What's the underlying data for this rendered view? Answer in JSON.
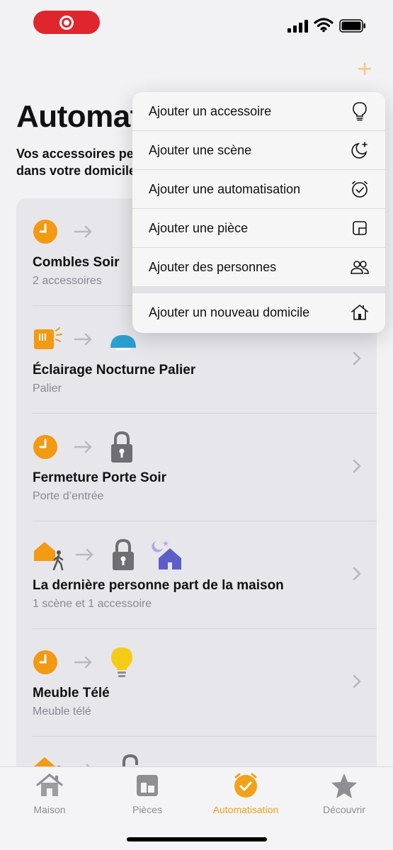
{
  "header": {
    "title": "Automatisation",
    "subtitle_line1": "Vos accessoires peuvent réagir",
    "subtitle_line2": "dans votre domicile",
    "add_label": "+"
  },
  "menu": {
    "items": [
      {
        "label": "Ajouter un accessoire",
        "icon": "lightbulb-icon"
      },
      {
        "label": "Ajouter une scène",
        "icon": "scene-icon"
      },
      {
        "label": "Ajouter une automatisation",
        "icon": "automation-clock-icon"
      },
      {
        "label": "Ajouter une pièce",
        "icon": "room-icon"
      },
      {
        "label": "Ajouter des personnes",
        "icon": "people-icon"
      },
      {
        "label": "Ajouter un nouveau domicile",
        "icon": "new-home-icon"
      }
    ]
  },
  "automations": [
    {
      "title": "Combles Soir",
      "subtitle": "2 accessoires",
      "trigger": "clock-icon",
      "targets": []
    },
    {
      "title": "Éclairage Nocturne Palier",
      "subtitle": "Palier",
      "trigger": "motion-sensor-icon",
      "targets": [
        "ceiling-lamp-icon"
      ]
    },
    {
      "title": "Fermeture Porte Soir",
      "subtitle": "Porte d’entrée",
      "trigger": "clock-icon",
      "targets": [
        "lock-icon"
      ]
    },
    {
      "title": "La dernière personne part de la maison",
      "subtitle": "1 scène et 1 accessoire",
      "trigger": "person-leaves-home-icon",
      "targets": [
        "lock-icon",
        "night-home-scene-icon"
      ]
    },
    {
      "title": "Meuble Télé",
      "subtitle": "Meuble télé",
      "trigger": "clock-icon",
      "targets": [
        "lightbulb-on-icon"
      ]
    }
  ],
  "tabs": [
    {
      "label": "Maison",
      "icon": "house-icon",
      "active": false
    },
    {
      "label": "Pièces",
      "icon": "rooms-icon",
      "active": false
    },
    {
      "label": "Automatisation",
      "icon": "automation-tab-icon",
      "active": true
    },
    {
      "label": "Découvrir",
      "icon": "star-icon",
      "active": false
    }
  ],
  "colors": {
    "accent": "#f2a21a",
    "record": "#e0262d",
    "menu_bg": "#f6f6f7",
    "card_bg": "#e6e6eb"
  }
}
